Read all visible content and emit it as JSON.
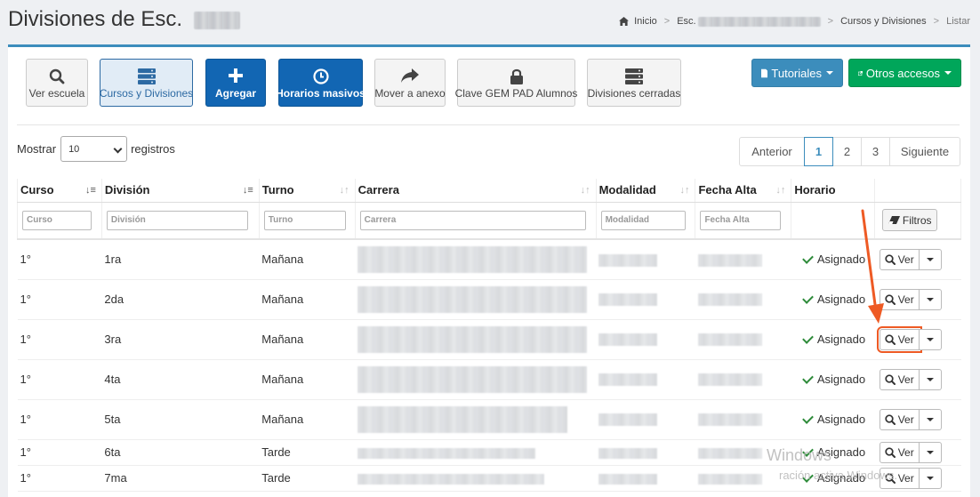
{
  "header": {
    "title": "Divisiones de Esc.",
    "breadcrumb": {
      "home": "Inicio",
      "school": "Esc.",
      "section": "Cursos y Divisiones",
      "current": "Listar"
    }
  },
  "toolbar": {
    "buttons": [
      {
        "label": "Ver escuela",
        "icon": "search-icon"
      },
      {
        "label": "Cursos y Divisiones",
        "icon": "server-icon"
      },
      {
        "label": "Agregar",
        "icon": "plus-icon"
      },
      {
        "label": "Horarios masivos",
        "icon": "clock-icon"
      },
      {
        "label": "Mover a anexo",
        "icon": "share-icon"
      },
      {
        "label": "Clave GEM PAD Alumnos",
        "icon": "lock-icon"
      },
      {
        "label": "Divisiones cerradas",
        "icon": "server-icon"
      }
    ],
    "tutoriales": "Tutoriales",
    "otros_accesos": "Otros accesos"
  },
  "length": {
    "prefix": "Mostrar",
    "value": "10",
    "suffix": "registros"
  },
  "pagination": {
    "prev": "Anterior",
    "pages": [
      "1",
      "2",
      "3"
    ],
    "current": "1",
    "next": "Siguiente"
  },
  "table": {
    "columns": [
      "Curso",
      "División",
      "Turno",
      "Carrera",
      "Modalidad",
      "Fecha Alta",
      "Horario"
    ],
    "filters": [
      "Curso",
      "División",
      "Turno",
      "Carrera",
      "Modalidad",
      "Fecha Alta"
    ],
    "filter_button": "Filtros",
    "view_label": "Ver",
    "rows": [
      {
        "curso": "1°",
        "division": "1ra",
        "turno": "Mañana",
        "horario": "Asignado"
      },
      {
        "curso": "1°",
        "division": "2da",
        "turno": "Mañana",
        "horario": "Asignado"
      },
      {
        "curso": "1°",
        "division": "3ra",
        "turno": "Mañana",
        "horario": "Asignado"
      },
      {
        "curso": "1°",
        "division": "4ta",
        "turno": "Mañana",
        "horario": "Asignado"
      },
      {
        "curso": "1°",
        "division": "5ta",
        "turno": "Mañana",
        "horario": "Asignado"
      },
      {
        "curso": "1°",
        "division": "6ta",
        "turno": "Tarde",
        "horario": "Asignado"
      },
      {
        "curso": "1°",
        "division": "7ma",
        "turno": "Tarde",
        "horario": "Asignado"
      }
    ]
  },
  "watermark": {
    "line1": "Windows",
    "line2": "ración activa Windows."
  },
  "colors": {
    "primary": "#1266b3",
    "info": "#3c8dbc",
    "success": "#00a65a",
    "highlight": "#ee5a24"
  }
}
